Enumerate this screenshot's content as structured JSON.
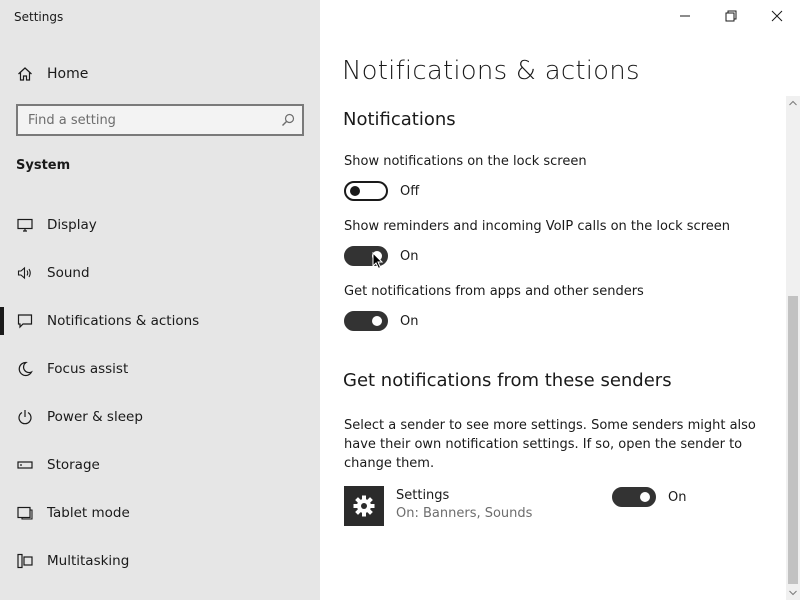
{
  "window": {
    "app_title": "Settings",
    "controls": {
      "minimize": "minimize",
      "restore": "restore",
      "close": "close"
    }
  },
  "sidebar": {
    "home_label": "Home",
    "home_icon": "home-icon",
    "search": {
      "placeholder": "Find a setting",
      "value": "",
      "icon": "search-icon"
    },
    "group_title": "System",
    "items": [
      {
        "label": "Display",
        "icon": "display-icon",
        "selected": false
      },
      {
        "label": "Sound",
        "icon": "speaker-icon",
        "selected": false
      },
      {
        "label": "Notifications & actions",
        "icon": "message-icon",
        "selected": true
      },
      {
        "label": "Focus assist",
        "icon": "moon-icon",
        "selected": false
      },
      {
        "label": "Power & sleep",
        "icon": "power-icon",
        "selected": false
      },
      {
        "label": "Storage",
        "icon": "storage-icon",
        "selected": false
      },
      {
        "label": "Tablet mode",
        "icon": "tablet-icon",
        "selected": false
      },
      {
        "label": "Multitasking",
        "icon": "multitasking-icon",
        "selected": false
      }
    ]
  },
  "main": {
    "page_title": "Notifications & actions",
    "notifications": {
      "section_title": "Notifications",
      "settings": [
        {
          "label": "Show notifications on the lock screen",
          "state": "Off",
          "on": false
        },
        {
          "label": "Show reminders and incoming VoIP calls on the lock screen",
          "state": "On",
          "on": true
        },
        {
          "label": "Get notifications from apps and other senders",
          "state": "On",
          "on": true
        }
      ]
    },
    "senders": {
      "section_title": "Get notifications from these senders",
      "description": "Select a sender to see more settings. Some senders might also have their own notification settings. If so, open the sender to change them.",
      "items": [
        {
          "name": "Settings",
          "subtitle": "On: Banners, Sounds",
          "state": "On",
          "on": true,
          "icon": "gear-icon"
        }
      ]
    }
  },
  "colors": {
    "sidebar_bg": "#e6e6e6",
    "toggle_on": "#333333",
    "text": "#1a1a1a",
    "muted_text": "#6d6d6d"
  }
}
